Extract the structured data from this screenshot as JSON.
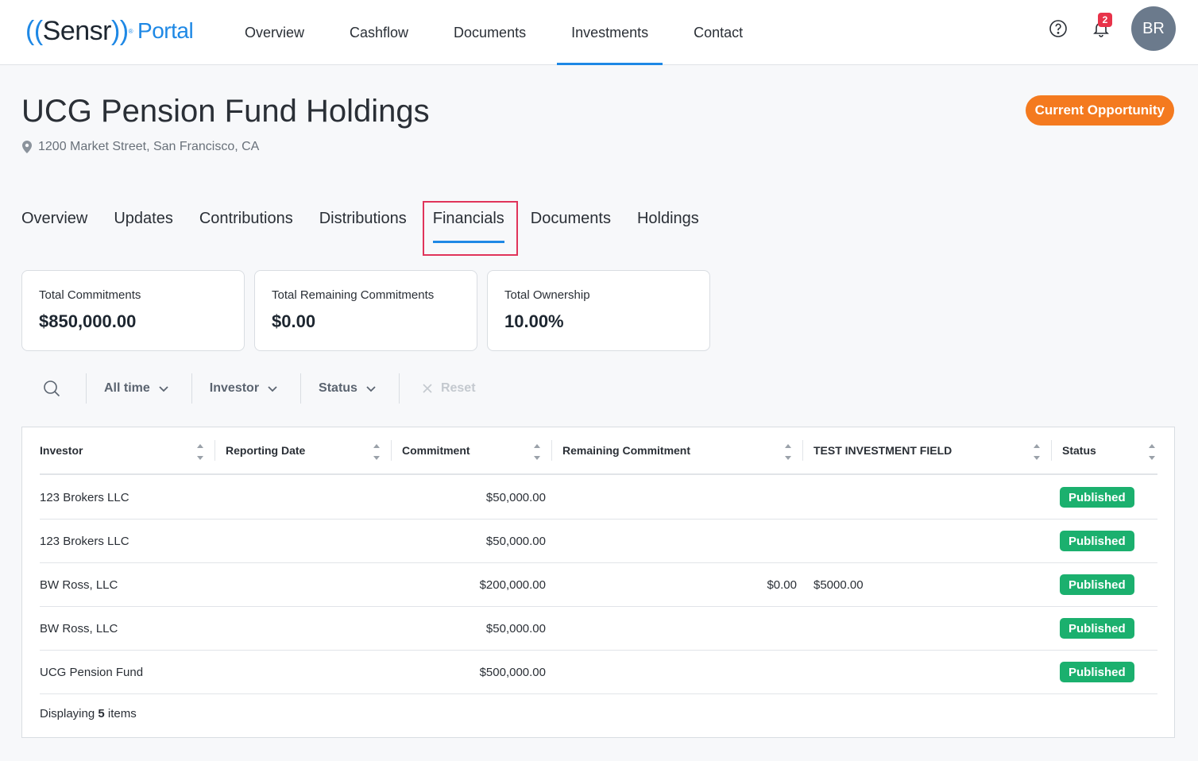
{
  "brand": {
    "open": "((",
    "name": "Sensr",
    "close": "))",
    "portal": "Portal",
    "reg": "®"
  },
  "nav": [
    "Overview",
    "Cashflow",
    "Documents",
    "Investments",
    "Contact"
  ],
  "notifications_count": "2",
  "user_initials": "BR",
  "page": {
    "title": "UCG Pension Fund Holdings",
    "address": "1200 Market Street, San Francisco, CA",
    "badge": "Current Opportunity"
  },
  "subtabs": [
    "Overview",
    "Updates",
    "Contributions",
    "Distributions",
    "Financials",
    "Documents",
    "Holdings"
  ],
  "cards": [
    {
      "label": "Total Commitments",
      "value": "$850,000.00"
    },
    {
      "label": "Total Remaining Commitments",
      "value": "$0.00"
    },
    {
      "label": "Total Ownership",
      "value": "10.00%"
    }
  ],
  "filters": {
    "time": "All time",
    "investor": "Investor",
    "status": "Status",
    "reset": "Reset"
  },
  "table": {
    "columns": [
      "Investor",
      "Reporting Date",
      "Commitment",
      "Remaining Commitment",
      "TEST INVESTMENT FIELD",
      "Status"
    ],
    "rows": [
      {
        "investor": "123 Brokers LLC",
        "reporting_date": "",
        "commitment": "$50,000.00",
        "remaining": "",
        "test_field": "",
        "status": "Published"
      },
      {
        "investor": "123 Brokers LLC",
        "reporting_date": "",
        "commitment": "$50,000.00",
        "remaining": "",
        "test_field": "",
        "status": "Published"
      },
      {
        "investor": "BW Ross, LLC",
        "reporting_date": "",
        "commitment": "$200,000.00",
        "remaining": "$0.00",
        "test_field": "$5000.00",
        "status": "Published"
      },
      {
        "investor": "BW Ross, LLC",
        "reporting_date": "",
        "commitment": "$50,000.00",
        "remaining": "",
        "test_field": "",
        "status": "Published"
      },
      {
        "investor": "UCG Pension Fund",
        "reporting_date": "",
        "commitment": "$500,000.00",
        "remaining": "",
        "test_field": "",
        "status": "Published"
      }
    ],
    "footer_prefix": "Displaying",
    "footer_count": "5",
    "footer_suffix": "items"
  },
  "colors": {
    "accent": "#1e88e5",
    "orange": "#f47a1f",
    "published": "#1bb06e",
    "notif": "#e8334a"
  }
}
